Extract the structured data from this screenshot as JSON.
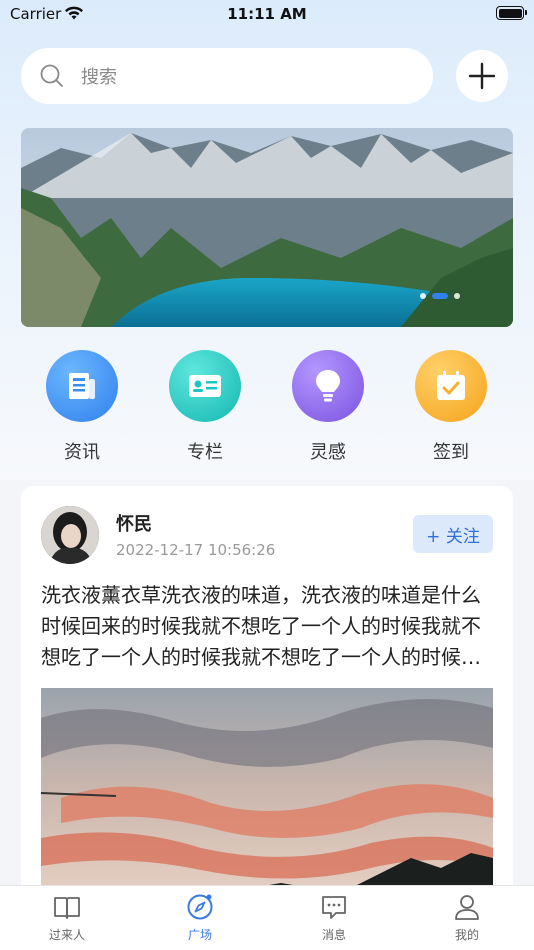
{
  "status_bar": {
    "carrier": "Carrier",
    "time": "11:11 AM"
  },
  "search": {
    "placeholder": "搜索"
  },
  "banner": {
    "dots": 3,
    "active_dot": 1
  },
  "quick_nav": [
    {
      "label": "资讯",
      "icon": "news-icon",
      "color": "#3a8ef0"
    },
    {
      "label": "专栏",
      "icon": "id-card-icon",
      "color": "#1cc7c1"
    },
    {
      "label": "灵感",
      "icon": "lightbulb-icon",
      "color": "#8a63ea"
    },
    {
      "label": "签到",
      "icon": "calendar-check-icon",
      "color": "#f7b02c"
    }
  ],
  "post": {
    "author": "怀民",
    "time": "2022-12-17 10:56:26",
    "follow_label": "+ 关注",
    "text": "洗衣液薰衣草洗衣液的味道，洗衣液的味道是什么时候回来的时候我就不想吃了一个人的时候我就不想吃了一个人的时候我就不想吃了一个人的时候我就不想吃了"
  },
  "tabs": [
    {
      "label": "过来人",
      "icon": "book-icon",
      "active": false
    },
    {
      "label": "广场",
      "icon": "compass-icon",
      "active": true
    },
    {
      "label": "消息",
      "icon": "message-icon",
      "active": false
    },
    {
      "label": "我的",
      "icon": "user-icon",
      "active": false
    }
  ],
  "colors": {
    "accent": "#3a7be0",
    "follow_bg": "#dce9fb"
  }
}
